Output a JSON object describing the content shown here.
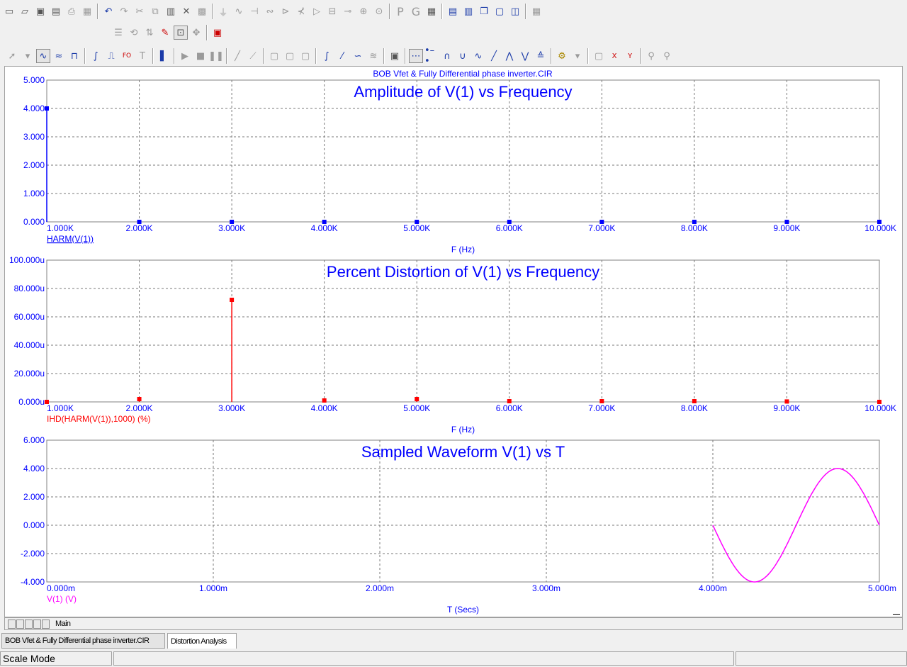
{
  "file_title": "BOB Vfet & Fully Differential phase inverter.CIR",
  "colors": {
    "blue": "#0000ff",
    "red": "#ff0000",
    "magenta": "#ff00ff",
    "grid": "#7a7a7a"
  },
  "toolbar": {
    "row1_font_letters": [
      "P",
      "G"
    ]
  },
  "chart_data": [
    {
      "type": "bar",
      "title": "Amplitude of V(1) vs Frequency",
      "xlabel": "F (Hz)",
      "series_label": "HARM(V(1))",
      "x_ticks": [
        "1.000K",
        "2.000K",
        "3.000K",
        "4.000K",
        "5.000K",
        "6.000K",
        "7.000K",
        "8.000K",
        "9.000K",
        "10.000K"
      ],
      "y_ticks": [
        "0.000",
        "1.000",
        "2.000",
        "3.000",
        "4.000",
        "5.000"
      ],
      "xlim": [
        1000,
        10000
      ],
      "ylim": [
        0,
        5
      ],
      "x": [
        1000,
        2000,
        3000,
        4000,
        5000,
        6000,
        7000,
        8000,
        9000,
        10000
      ],
      "values": [
        4.0,
        0.0,
        0.0,
        0.0,
        0.0,
        0.0,
        0.0,
        0.0,
        0.0,
        0.0
      ],
      "color": "#0000ff",
      "grid": true
    },
    {
      "type": "bar",
      "title": "Percent Distortion of V(1) vs Frequency",
      "xlabel": "F (Hz)",
      "series_label": "IHD(HARM(V(1)),1000) (%)",
      "x_ticks": [
        "1.000K",
        "2.000K",
        "3.000K",
        "4.000K",
        "5.000K",
        "6.000K",
        "7.000K",
        "8.000K",
        "9.000K",
        "10.000K"
      ],
      "y_ticks": [
        "0.000u",
        "20.000u",
        "40.000u",
        "60.000u",
        "80.000u",
        "100.000u"
      ],
      "xlim": [
        1000,
        10000
      ],
      "ylim": [
        0,
        100
      ],
      "x": [
        1000,
        2000,
        3000,
        4000,
        5000,
        6000,
        7000,
        8000,
        9000,
        10000
      ],
      "values": [
        0.0,
        2.0,
        72.0,
        1.0,
        2.0,
        0.5,
        0.5,
        0.5,
        0.3,
        0.0
      ],
      "color": "#ff0000",
      "grid": true
    },
    {
      "type": "line",
      "title": "Sampled Waveform  V(1) vs T",
      "xlabel": "T (Secs)",
      "series_label": "V(1) (V)",
      "x_ticks": [
        "0.000m",
        "1.000m",
        "2.000m",
        "3.000m",
        "4.000m",
        "5.000m"
      ],
      "y_ticks": [
        "-4.000",
        "-2.000",
        "0.000",
        "2.000",
        "4.000",
        "6.000"
      ],
      "xlim": [
        0,
        5
      ],
      "ylim": [
        -4,
        6
      ],
      "amplitude": 4.0,
      "frequency_khz": 1.0,
      "t_start": 4.0,
      "t_end": 5.0,
      "color": "#ff00ff",
      "grid": true
    }
  ],
  "bottom_tab": "Main",
  "tabs": [
    "BOB Vfet & Fully Differential phase inverter.CIR",
    "Distortion Analysis"
  ],
  "status": {
    "mode": "Scale Mode"
  }
}
